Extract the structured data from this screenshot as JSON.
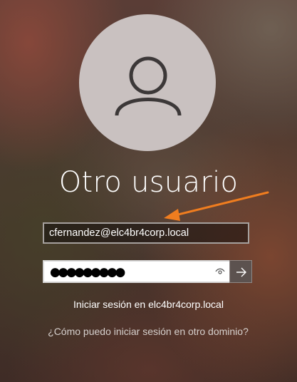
{
  "login": {
    "user_display_name": "Otro usuario",
    "username_value": "cfernandez@elc4br4corp.local",
    "password_masked": "●●●●●●●●●",
    "signin_domain_text": "Iniciar sesión en elc4br4corp.local",
    "other_domain_link": "¿Cómo puedo iniciar sesión en otro dominio?"
  },
  "icons": {
    "avatar": "user-silhouette-icon",
    "reveal_password": "eye-icon",
    "submit": "arrow-right-icon",
    "annotation": "orange-arrow"
  },
  "colors": {
    "annotation_arrow": "#f07d1f",
    "avatar_bg": "#c9c1c0",
    "submit_bg": "#5c524f"
  }
}
